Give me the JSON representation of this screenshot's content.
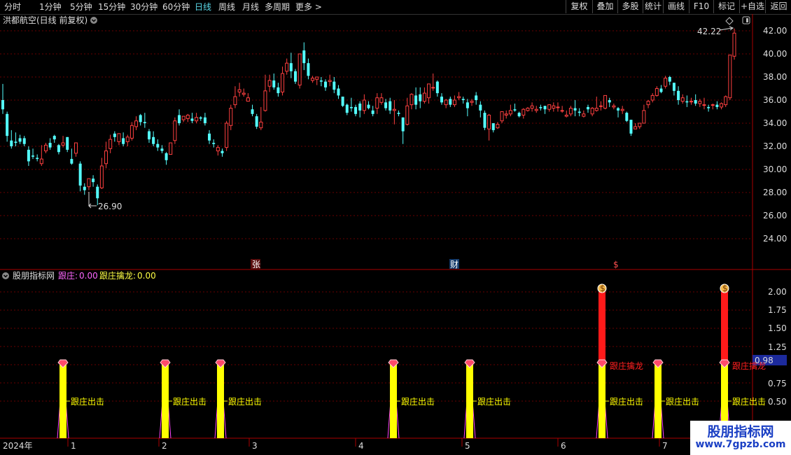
{
  "toolbar": {
    "periods": [
      "分时",
      "1分钟",
      "5分钟",
      "15分钟",
      "30分钟",
      "60分钟",
      "日线",
      "周线",
      "月线",
      "多周期",
      "更多 >"
    ],
    "active_period": "日线",
    "right_buttons": [
      "复权",
      "叠加",
      "多股",
      "统计",
      "画线",
      "F10",
      "标记",
      "+自选",
      "返回"
    ]
  },
  "main_chart": {
    "title": "洪都航空(日线 前复权)",
    "price_axis": [
      "42.00",
      "40.00",
      "38.00",
      "36.00",
      "34.00",
      "32.00",
      "30.00",
      "28.00",
      "26.00",
      "24.00"
    ],
    "high_label": "42.22",
    "low_label": "26.90",
    "event_markers": [
      "张",
      "财",
      "$"
    ]
  },
  "indicator": {
    "name": "股朋指标网",
    "line1_label": "跟庄:",
    "line1_value": "0.00",
    "line2_label": "跟庄擒龙:",
    "line2_value": "0.00",
    "axis": [
      "2.00",
      "1.75",
      "1.50",
      "1.25",
      "0.75",
      "0.50"
    ],
    "current_value": "0.98",
    "signal_text": "跟庄出击",
    "dragon_text": "跟庄擒龙",
    "signals": [
      {
        "dragon": false
      },
      {
        "dragon": false
      },
      {
        "dragon": false
      },
      {
        "dragon": false
      },
      {
        "dragon": false
      },
      {
        "dragon": true
      },
      {
        "dragon": false
      },
      {
        "dragon": true
      }
    ]
  },
  "time_axis": {
    "year_label": "2024年",
    "months": [
      "1",
      "2",
      "3",
      "4",
      "5",
      "6",
      "7"
    ]
  },
  "chart_data": {
    "type": "candlestick",
    "ylim": [
      23,
      43
    ],
    "candles": [
      [
        36,
        37.4,
        35.2,
        34.8
      ],
      [
        34.8,
        35,
        32.9,
        32.4
      ],
      [
        32.5,
        33.4,
        32,
        31.8
      ],
      [
        32.4,
        33.2,
        32.3,
        32
      ],
      [
        32.7,
        33,
        32.4,
        32.2
      ],
      [
        32.7,
        32.9,
        32.2,
        32
      ],
      [
        31.7,
        32,
        30.7,
        30.3
      ],
      [
        31.2,
        31.8,
        31.1,
        30.9
      ],
      [
        31,
        31.3,
        30.9,
        30.7
      ],
      [
        30.5,
        32.1,
        30.9,
        30.3
      ],
      [
        31.6,
        32.3,
        32.1,
        31.4
      ],
      [
        32.3,
        32.7,
        31.9,
        31.7
      ],
      [
        32.9,
        33,
        32.6,
        32.3
      ],
      [
        32.1,
        32.2,
        31.5,
        31.3
      ],
      [
        32.1,
        32.9,
        32.3,
        31.9
      ],
      [
        32.8,
        32.8,
        31.7,
        31.5
      ],
      [
        30.9,
        31.8,
        30.5,
        30.4
      ],
      [
        31.4,
        32.3,
        32.3,
        31.1
      ],
      [
        30.5,
        30.7,
        28.6,
        28.1
      ],
      [
        28.5,
        28.8,
        28.2,
        27.8
      ],
      [
        28.5,
        28.9,
        29.2,
        28.2
      ],
      [
        29.2,
        29.5,
        28.9,
        28.5
      ],
      [
        28.5,
        28.7,
        27.5,
        26.9
      ],
      [
        28.4,
        31,
        30.3,
        28.3
      ],
      [
        30.5,
        32.4,
        31.6,
        30.1
      ],
      [
        31.8,
        33,
        32.6,
        31.4
      ],
      [
        33.1,
        33.3,
        32.8,
        32.4
      ],
      [
        32.4,
        32.7,
        33.1,
        32.1
      ],
      [
        32.7,
        33.2,
        32.2,
        32
      ],
      [
        32.4,
        33,
        32.8,
        32
      ],
      [
        32.7,
        34.1,
        33.8,
        32.5
      ],
      [
        33.7,
        34.6,
        34.2,
        33.4
      ],
      [
        34.7,
        34.8,
        34.1,
        33.8
      ],
      [
        34.1,
        34.9,
        34,
        33.6
      ],
      [
        33.3,
        33.5,
        32.6,
        32.3
      ],
      [
        32.8,
        33.3,
        32.2,
        32
      ],
      [
        32.2,
        32.6,
        31.9,
        31.6
      ],
      [
        31.8,
        32.1,
        31.6,
        31.4
      ],
      [
        31.4,
        31.5,
        30.8,
        30.4
      ],
      [
        31.3,
        32.2,
        32.3,
        31.3
      ],
      [
        32.5,
        34.5,
        34.2,
        32.2
      ],
      [
        34.7,
        35.2,
        34,
        33.8
      ],
      [
        34.3,
        34.6,
        34.6,
        34.1
      ],
      [
        34.4,
        34.8,
        34.7,
        34.1
      ],
      [
        34.4,
        34.9,
        34.2,
        34
      ],
      [
        34.2,
        34.9,
        34.5,
        34
      ],
      [
        34.5,
        34.6,
        34.4,
        34.2
      ],
      [
        34.5,
        34.9,
        34,
        33.8
      ],
      [
        33.1,
        33.4,
        32.5,
        32.2
      ],
      [
        32.3,
        32.6,
        32.2,
        31.9
      ],
      [
        31.6,
        32.1,
        31.9,
        31.2
      ],
      [
        31.6,
        31.8,
        31.4,
        31.1
      ],
      [
        31.9,
        34.2,
        34,
        31.6
      ],
      [
        33.8,
        35.6,
        35.3,
        33.4
      ],
      [
        35.6,
        37.2,
        36.3,
        35.3
      ],
      [
        36.7,
        37.5,
        36.9,
        36.3
      ],
      [
        36.5,
        37,
        36.6,
        36.3
      ],
      [
        35.9,
        36.6,
        36.2,
        35.9
      ],
      [
        35.2,
        35.6,
        34.8,
        34.6
      ],
      [
        34.6,
        34.8,
        33.7,
        33.5
      ],
      [
        33.6,
        35.4,
        34.1,
        33.4
      ],
      [
        35.1,
        38.2,
        36.8,
        35
      ],
      [
        37.2,
        38.2,
        37.7,
        36.7
      ],
      [
        37.7,
        38.3,
        37.1,
        36.9
      ],
      [
        37.1,
        37.5,
        36.6,
        36.3
      ],
      [
        36.7,
        38.9,
        38.3,
        36.4
      ],
      [
        38.5,
        39.6,
        39.2,
        38.2
      ],
      [
        39.2,
        40.1,
        38.5,
        37.9
      ],
      [
        38.5,
        38.7,
        37.6,
        37.4
      ],
      [
        37.3,
        39.7,
        40,
        37
      ],
      [
        40.3,
        41,
        39.2,
        38.6
      ],
      [
        39.2,
        39.6,
        38.1,
        37.8
      ],
      [
        37.7,
        38.1,
        37.9,
        37.5
      ],
      [
        37.8,
        38,
        38,
        37.3
      ],
      [
        37.7,
        38,
        37.6,
        37.2
      ],
      [
        37.6,
        37.8,
        37.1,
        36.8
      ],
      [
        37.6,
        38.2,
        37.7,
        37.2
      ],
      [
        37.6,
        38,
        36.9,
        36.6
      ],
      [
        37,
        37.3,
        36.4,
        36.1
      ],
      [
        36.3,
        36.3,
        35.5,
        35.4
      ],
      [
        35.6,
        35.7,
        34.9,
        34.7
      ],
      [
        35.4,
        36.2,
        35.3,
        35
      ],
      [
        35.4,
        35.6,
        34.8,
        34.6
      ],
      [
        35.7,
        35.9,
        35.1,
        34.5
      ],
      [
        35.1,
        36.5,
        36,
        34.8
      ],
      [
        35.6,
        35.9,
        35.3,
        35.2
      ],
      [
        35.1,
        35.5,
        34.8,
        34.6
      ],
      [
        35.3,
        36.6,
        36.2,
        34.8
      ],
      [
        35.8,
        36.6,
        36.2,
        35.6
      ],
      [
        35.8,
        36.1,
        35.3,
        35.1
      ],
      [
        35.9,
        36.2,
        35.1,
        34.8
      ],
      [
        35.1,
        36,
        35.2,
        33.9
      ],
      [
        34.9,
        35.1,
        34.8,
        34.6
      ],
      [
        34.5,
        34.5,
        33.3,
        32.2
      ],
      [
        33.9,
        36.2,
        35.5,
        33.8
      ],
      [
        35.6,
        36.6,
        36.5,
        35.2
      ],
      [
        36.4,
        37.1,
        35.6,
        35.2
      ],
      [
        36.5,
        37.1,
        35.9,
        35.3
      ],
      [
        35.9,
        37.1,
        36.6,
        35.7
      ],
      [
        36.2,
        37.4,
        37.4,
        35.7
      ],
      [
        37.1,
        38.3,
        37.1,
        36.8
      ],
      [
        37.6,
        37.7,
        36.6,
        36.3
      ],
      [
        36.3,
        36.6,
        35.8,
        35.6
      ],
      [
        35.6,
        36.1,
        36,
        35.3
      ],
      [
        36.1,
        36.3,
        35.6,
        35.4
      ],
      [
        35.6,
        36.4,
        36,
        35.4
      ],
      [
        36.2,
        36.7,
        36.3,
        36
      ],
      [
        36.1,
        36.3,
        36,
        35.7
      ],
      [
        35.8,
        36.1,
        35.3,
        34.6
      ],
      [
        35.8,
        36.1,
        35.9,
        35.5
      ],
      [
        36.4,
        36.7,
        36,
        35.6
      ],
      [
        35.6,
        35.9,
        35.1,
        34.5
      ],
      [
        34.9,
        35.1,
        33.6,
        33.4
      ],
      [
        33.5,
        34.8,
        34.7,
        32.5
      ],
      [
        34,
        34,
        33.4,
        33.2
      ],
      [
        33.6,
        34.1,
        33.9,
        33.5
      ],
      [
        34.2,
        34.2,
        35,
        34
      ],
      [
        34.7,
        35.1,
        34.8,
        34.4
      ],
      [
        34.8,
        35.6,
        35.1,
        34.6
      ],
      [
        35.2,
        35.7,
        35.1,
        35
      ],
      [
        34.9,
        35,
        34.6,
        34.5
      ],
      [
        34.7,
        35.3,
        35.2,
        34.4
      ],
      [
        35.1,
        35.4,
        35.3,
        35
      ],
      [
        35.3,
        35.8,
        35.5,
        35
      ],
      [
        35.1,
        35.5,
        35.2,
        34.9
      ],
      [
        35.4,
        35.6,
        35.3,
        35.1
      ],
      [
        35.5,
        35.5,
        35.2,
        34.8
      ],
      [
        35.2,
        35.6,
        35.6,
        35
      ],
      [
        35.3,
        35.8,
        35.5,
        35
      ],
      [
        35.4,
        35.8,
        35.4,
        35
      ],
      [
        35.1,
        35.5,
        35.1,
        34.9
      ],
      [
        34.6,
        35.1,
        34.7,
        34.5
      ],
      [
        34.8,
        35.5,
        35.3,
        34.6
      ],
      [
        35.3,
        36,
        35.1,
        34.6
      ],
      [
        35,
        35.3,
        34.9,
        34.6
      ],
      [
        34.6,
        35.1,
        34.8,
        34.5
      ],
      [
        35.4,
        35.6,
        35.2,
        34.9
      ],
      [
        34.8,
        35.4,
        35.3,
        34.6
      ],
      [
        35.1,
        36.3,
        35.3,
        35
      ],
      [
        35.5,
        35.9,
        35.5,
        35.1
      ],
      [
        35.3,
        36.3,
        36.4,
        35.2
      ],
      [
        36,
        36.2,
        35.8,
        35.4
      ],
      [
        35.4,
        35.7,
        35.5,
        35.2
      ],
      [
        35.3,
        35.4,
        35.1,
        34.5
      ],
      [
        35.1,
        35.5,
        35.2,
        34.8
      ],
      [
        34.9,
        35,
        34.2,
        34.1
      ],
      [
        34.3,
        34.3,
        33.1,
        32.9
      ],
      [
        33.5,
        34,
        33.7,
        33.5
      ],
      [
        33.7,
        34,
        34,
        33.5
      ],
      [
        34,
        35.6,
        35.1,
        34
      ],
      [
        35.6,
        36,
        35.9,
        35.3
      ],
      [
        36,
        36.6,
        36.4,
        35.8
      ],
      [
        36.4,
        37.2,
        37,
        36.3
      ],
      [
        37,
        37.3,
        36.7,
        36.6
      ],
      [
        37.2,
        38.1,
        37.9,
        37
      ],
      [
        38,
        38.1,
        37.6,
        37.3
      ],
      [
        37.5,
        37.5,
        36.8,
        36.4
      ],
      [
        36.8,
        37.2,
        36,
        35.6
      ],
      [
        35.9,
        36.5,
        36.2,
        35.7
      ],
      [
        35.9,
        36.4,
        35.8,
        35.4
      ],
      [
        35.9,
        36.2,
        35.9,
        35.6
      ],
      [
        36,
        36.5,
        35.7,
        35.5
      ],
      [
        35.7,
        36.1,
        35.9,
        35.4
      ],
      [
        35.6,
        36.2,
        35.6,
        35.2
      ],
      [
        35.4,
        35.6,
        35.3,
        35
      ],
      [
        35.6,
        35.7,
        35.6,
        35.2
      ],
      [
        35.6,
        35.9,
        35.4,
        35.2
      ],
      [
        35.4,
        35.8,
        35.7,
        35.2
      ],
      [
        35.6,
        36.4,
        36.3,
        35.4
      ],
      [
        36.2,
        39.7,
        39.9,
        36
      ],
      [
        39.8,
        42.2,
        41.8,
        39.5
      ]
    ]
  }
}
